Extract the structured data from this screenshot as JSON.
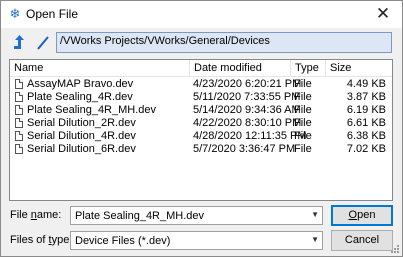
{
  "window": {
    "title": "Open File",
    "icon": "snowflake-icon",
    "close_glyph": "✕"
  },
  "nav": {
    "up_icon": "up-arrow-icon",
    "root_icon": "slash-icon",
    "path": "/VWorks Projects/VWorks/General/Devices"
  },
  "list": {
    "columns": [
      "Name",
      "Date modified",
      "Type",
      "Size"
    ],
    "rows": [
      {
        "name": "AssayMAP Bravo.dev",
        "date": "4/23/2020 6:20:21 PM",
        "type": "File",
        "size": "4.49 KB"
      },
      {
        "name": "Plate Sealing_4R.dev",
        "date": "5/11/2020 7:33:55 PM",
        "type": "File",
        "size": "3.87 KB"
      },
      {
        "name": "Plate Sealing_4R_MH.dev",
        "date": "5/14/2020 9:34:36 AM",
        "type": "File",
        "size": "6.19 KB"
      },
      {
        "name": "Serial Dilution_2R.dev",
        "date": "4/22/2020 8:30:10 PM",
        "type": "File",
        "size": "6.61 KB"
      },
      {
        "name": "Serial Dilution_4R.dev",
        "date": "4/28/2020 12:11:35 PM",
        "type": "File",
        "size": "6.38 KB"
      },
      {
        "name": "Serial Dilution_6R.dev",
        "date": "5/7/2020 3:36:47 PM",
        "type": "File",
        "size": "7.02 KB"
      }
    ]
  },
  "form": {
    "file_name_label_prefix": "File ",
    "file_name_label_key": "n",
    "file_name_label_suffix": "ame:",
    "file_name_value": "Plate Sealing_4R_MH.dev",
    "file_type_label_prefix": "Files of ",
    "file_type_label_key": "t",
    "file_type_label_suffix": "ype:",
    "file_type_value": "Device Files (*.dev)",
    "open_label_key": "O",
    "open_label_rest": "pen",
    "cancel_label": "Cancel"
  }
}
